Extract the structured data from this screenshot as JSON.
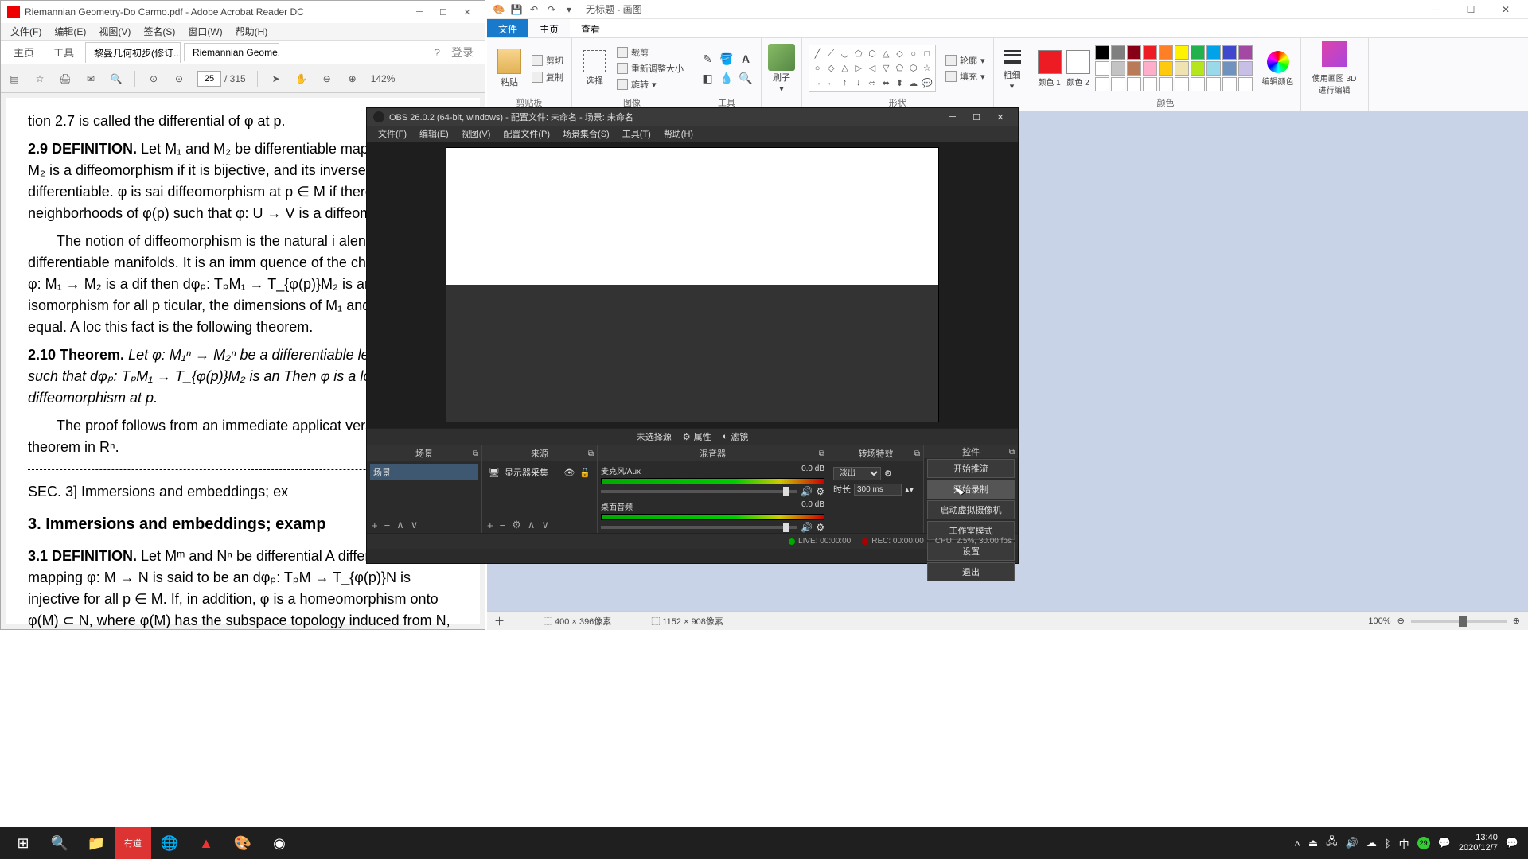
{
  "acrobat": {
    "title": "Riemannian Geometry-Do Carmo.pdf - Adobe Acrobat Reader DC",
    "menu": [
      "文件(F)",
      "编辑(E)",
      "视图(V)",
      "签名(S)",
      "窗口(W)",
      "帮助(H)"
    ],
    "home": "主页",
    "tools": "工具",
    "tabs": [
      "黎曼几何初步(修订...",
      "Riemannian Geome..."
    ],
    "login": "登录",
    "page_current": "25",
    "page_total": "/ 315",
    "zoom": "142%",
    "content": {
      "l0": "tion 2.7 is called the differential of φ at p.",
      "d29": "2.9 DEFINITION.",
      "p29": "Let M₁ and M₂ be differentiable mapping φ: M₁ → M₂ is a diffeomorphism if it is bijective, and its inverse φ⁻¹ is differentiable.  φ is sai diffeomorphism at p ∈ M if there exist neighborhoods of φ(p) such that φ: U → V is a diffeomorphism.",
      "p29b": "The notion of diffeomorphism is the natural i alence between differentiable manifolds.  It is an imm quence of the chain rule that if φ: M₁ → M₂ is a dif then dφₚ: TₚM₁ → T_{φ(p)}M₂ is an isomorphism for all p ticular, the dimensions of M₁ and M₂ are equal.  A loc this fact is the following theorem.",
      "t210": "2.10 Theorem.",
      "p210": "Let φ: M₁ⁿ → M₂ⁿ  be a differentiable let p ∈ M₁ be such that dφₚ: TₚM₁ → T_{φ(p)}M₂ is an Then φ is a local diffeomorphism at p.",
      "p210b": "The proof follows from an immediate applicat verse function theorem in Rⁿ.",
      "sec": "SEC. 3]          Immersions and embeddings; ex",
      "h3": "3.  Immersions and embeddings; examp",
      "d31": "3.1 DEFINITION.",
      "p31": "Let Mᵐ and Nⁿ be differential A differentiable mapping φ: M → N is said to be an dφₚ: TₚM → T_{φ(p)}N is injective for all p ∈ M. If, in addition, φ is a homeomorphism onto φ(M) ⊂ N, where φ(M) has the subspace topology induced from N, we say that φ is an embedding. If M ⊂ N and the inclusion i: M ⊂ N is an embedding, we say that M is a"
    }
  },
  "paint": {
    "title": "无标题 - 画图",
    "tabs": {
      "file": "文件",
      "home": "主页",
      "view": "查看"
    },
    "groups": {
      "clipboard": {
        "label": "剪贴板",
        "paste": "粘贴",
        "cut": "剪切",
        "copy": "复制"
      },
      "image": {
        "label": "图像",
        "select": "选择",
        "crop": "裁剪",
        "resize": "重新调整大小",
        "rotate": "旋转"
      },
      "tools": {
        "label": "工具"
      },
      "brushes": {
        "label": "刷子",
        "btn": "刷子"
      },
      "shapes": {
        "label": "形状",
        "outline": "轮廓",
        "fill": "填充"
      },
      "size": {
        "label": "粗细",
        "btn": "粗细"
      },
      "colors": {
        "label": "颜色",
        "c1": "颜色 1",
        "c2": "颜色 2",
        "edit": "编辑颜色"
      },
      "edit3d": {
        "label": "使用画图 3D 进行编辑"
      }
    },
    "palette": [
      "#000",
      "#7f7f7f",
      "#880015",
      "#ed1c24",
      "#ff7f27",
      "#fff200",
      "#22b14c",
      "#00a2e8",
      "#3f48cc",
      "#a349a4",
      "#fff",
      "#c3c3c3",
      "#b97a57",
      "#ffaec9",
      "#ffc90e",
      "#efe4b0",
      "#b5e61d",
      "#99d9ea",
      "#7092be",
      "#c8bfe7",
      "#fff",
      "#fff",
      "#fff",
      "#fff",
      "#fff",
      "#fff",
      "#fff",
      "#fff",
      "#fff",
      "#fff"
    ],
    "c1": "#ed1c24",
    "c2": "#ffffff",
    "status": {
      "pos": "十",
      "sel": "⬚ 400 × 396像素",
      "canvas": "⬚ 1152 × 908像素",
      "zoom": "100%"
    }
  },
  "obs": {
    "title": "OBS 26.0.2 (64-bit, windows) - 配置文件: 未命名 - 场景: 未命名",
    "menu": [
      "文件(F)",
      "编辑(E)",
      "视图(V)",
      "配置文件(P)",
      "场景集合(S)",
      "工具(T)",
      "帮助(H)"
    ],
    "toolbar": {
      "nosrc": "未选择源",
      "props": "属性",
      "filters": "滤镜"
    },
    "panels": {
      "scenes": {
        "title": "场景",
        "item": "场景"
      },
      "sources": {
        "title": "来源",
        "item": "显示器采集"
      },
      "mixer": {
        "title": "混音器",
        "ch1": "麦克风/Aux",
        "ch2": "桌面音频",
        "db": "0.0 dB"
      },
      "trans": {
        "title": "转场特效",
        "fade": "淡出",
        "dur_lbl": "时长",
        "dur": "300 ms"
      },
      "controls": {
        "title": "控件",
        "items": [
          "开始推流",
          "开始录制",
          "启动虚拟摄像机",
          "工作室模式",
          "设置",
          "退出"
        ]
      }
    },
    "status": {
      "live": "LIVE: 00:00:00",
      "rec": "REC: 00:00:00",
      "cpu": "CPU: 2.5%, 30.00 fps"
    }
  },
  "taskbar": {
    "time": "13:40",
    "date": "2020/12/7"
  }
}
